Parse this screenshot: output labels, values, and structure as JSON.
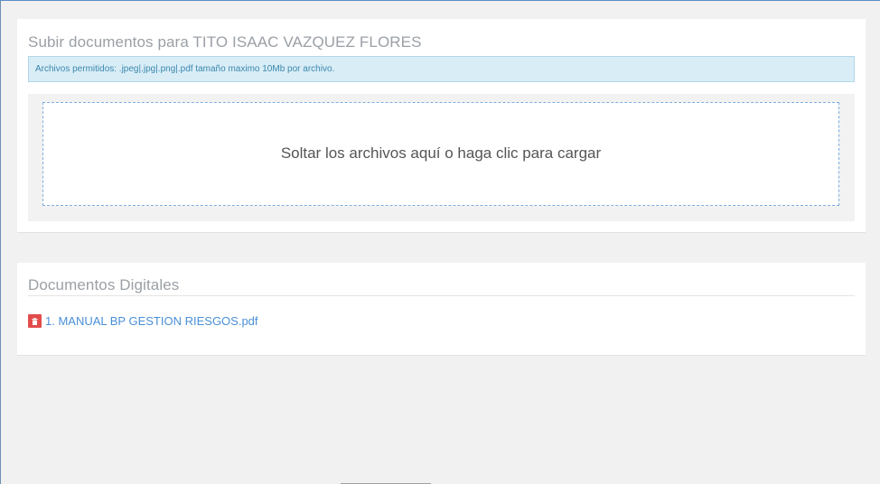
{
  "upload_panel": {
    "title": "Subir documentos para TITO ISAAC VAZQUEZ FLORES",
    "info_text": "Archivos permitidos: .jpeg|.jpg|.png|.pdf tamaño maximo 10Mb por archivo.",
    "dropzone_message": "Soltar los archivos aquí o haga clic para cargar"
  },
  "documents_panel": {
    "title": "Documentos Digitales",
    "items": [
      {
        "label": "1. MANUAL BP GESTION RIESGOS.pdf",
        "delete_icon": "trash-icon"
      }
    ]
  },
  "colors": {
    "info_bg": "#d9edf7",
    "info_text": "#3a87ad",
    "dropzone_border": "#7aaee0",
    "link": "#4a8fd8",
    "danger": "#e24c4b"
  }
}
